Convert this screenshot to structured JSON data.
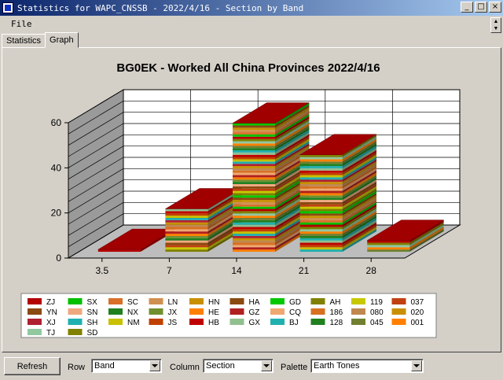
{
  "window": {
    "title": "Statistics for WAPC_CNSSB - 2022/4/16 - Section by Band",
    "controls": [
      "_",
      "□",
      "×"
    ]
  },
  "menu": {
    "file_label": "File"
  },
  "tabs": [
    {
      "label": "Statistics",
      "active": false
    },
    {
      "label": "Graph",
      "active": true
    }
  ],
  "chart_data": {
    "type": "bar",
    "title": "BG0EK - Worked All China Provinces 2022/4/16",
    "categories": [
      "3.5",
      "7",
      "14",
      "21",
      "28"
    ],
    "ylim": [
      0,
      60
    ],
    "yticks": [
      0,
      20,
      40,
      60
    ],
    "totals": [
      1,
      19,
      57,
      43,
      5
    ],
    "grid": true,
    "legend_position": "bottom",
    "legend": [
      "ZJ",
      "SX",
      "SC",
      "LN",
      "HN",
      "HA",
      "GD",
      "AH",
      "119",
      "037",
      "YN",
      "SN",
      "NX",
      "JX",
      "HE",
      "GZ",
      "CQ",
      "186",
      "080",
      "020",
      "XJ",
      "SH",
      "NM",
      "JS",
      "HB",
      "GX",
      "BJ",
      "128",
      "045",
      "001",
      "TJ",
      "SD"
    ],
    "palette_colors": [
      "#b30000",
      "#00c000",
      "#d8702a",
      "#d09050",
      "#c89000",
      "#8a4a10",
      "#00c800",
      "#808000",
      "#c8c800",
      "#c04010",
      "#8a4a10",
      "#f0a880",
      "#208020",
      "#709030",
      "#ff8000",
      "#b02020",
      "#f0a870",
      "#d87020",
      "#c08850",
      "#c89000",
      "#b02030",
      "#20b0b0",
      "#c8c000",
      "#c04000",
      "#c00000",
      "#90c090",
      "#20b0b0",
      "#208020",
      "#708030",
      "#ff8000",
      "#90c8a0",
      "#808000"
    ]
  },
  "bottom": {
    "refresh_label": "Refresh",
    "row_label": "Row",
    "row_value": "Band",
    "column_label": "Column",
    "column_value": "Section",
    "palette_label": "Palette",
    "palette_value": "Earth Tones"
  }
}
